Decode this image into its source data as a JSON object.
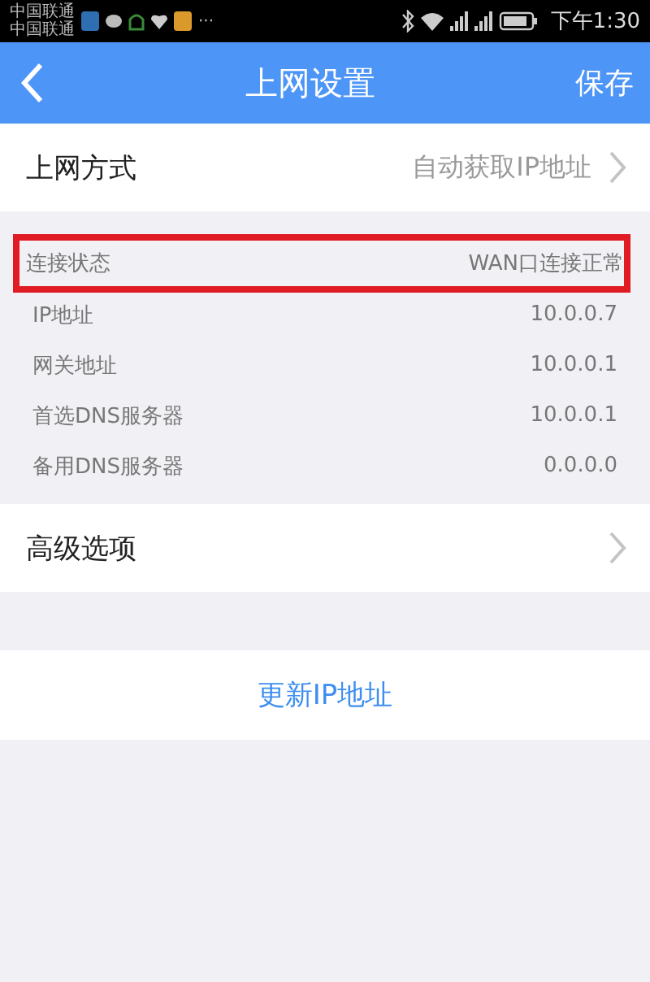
{
  "status_bar": {
    "carriers": [
      "中国联通",
      "中国联通"
    ],
    "more": "···",
    "time": "下午1:30"
  },
  "header": {
    "title": "上网设置",
    "action": "保存"
  },
  "mode_row": {
    "label": "上网方式",
    "value": "自动获取IP地址"
  },
  "info_rows": [
    {
      "label": "连接状态",
      "value": "WAN口连接正常",
      "highlighted": true
    },
    {
      "label": "IP地址",
      "value": "10.0.0.7",
      "highlighted": false
    },
    {
      "label": "网关地址",
      "value": "10.0.0.1",
      "highlighted": false
    },
    {
      "label": "首选DNS服务器",
      "value": "10.0.0.1",
      "highlighted": false
    },
    {
      "label": "备用DNS服务器",
      "value": "0.0.0.0",
      "highlighted": false
    }
  ],
  "advanced_row": {
    "label": "高级选项"
  },
  "renew_button": "更新IP地址"
}
